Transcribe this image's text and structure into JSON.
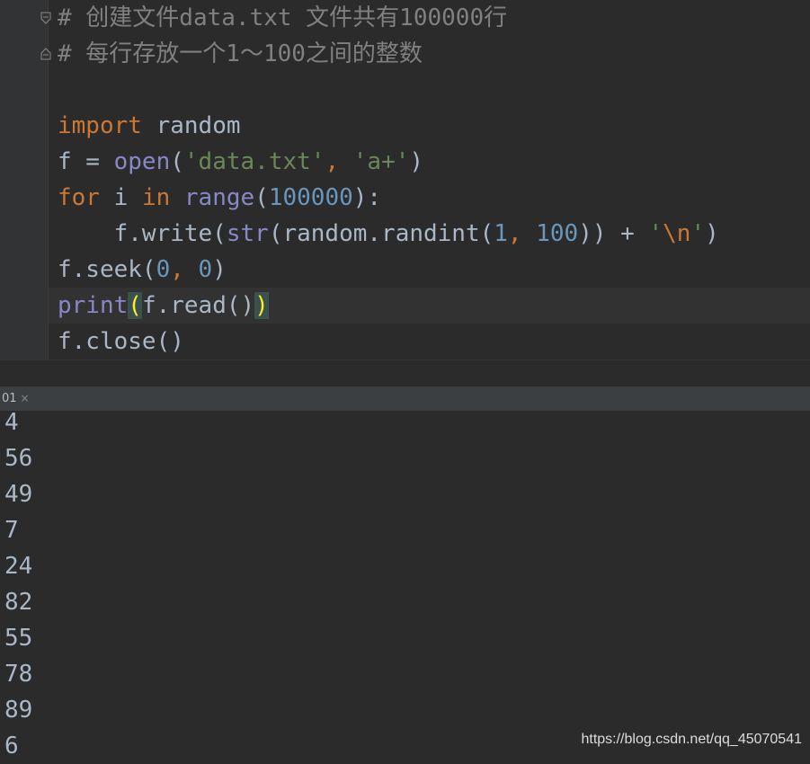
{
  "editor": {
    "lines": [
      {
        "tokens": [
          {
            "t": "# 创建文件data.txt 文件共有100000行",
            "c": "cm"
          }
        ]
      },
      {
        "tokens": [
          {
            "t": "# 每行存放一个1～100之间的整数",
            "c": "cm"
          }
        ]
      },
      {
        "tokens": []
      },
      {
        "tokens": [
          {
            "t": "import",
            "c": "kw"
          },
          {
            "t": " random",
            "c": ""
          }
        ]
      },
      {
        "tokens": [
          {
            "t": "f = ",
            "c": ""
          },
          {
            "t": "open",
            "c": "bi"
          },
          {
            "t": "(",
            "c": ""
          },
          {
            "t": "'data.txt'",
            "c": "str"
          },
          {
            "t": ", ",
            "c": "kw"
          },
          {
            "t": "'a+'",
            "c": "str"
          },
          {
            "t": ")",
            "c": ""
          }
        ]
      },
      {
        "tokens": [
          {
            "t": "for",
            "c": "kw"
          },
          {
            "t": " i ",
            "c": ""
          },
          {
            "t": "in",
            "c": "kw"
          },
          {
            "t": " ",
            "c": ""
          },
          {
            "t": "range",
            "c": "bi"
          },
          {
            "t": "(",
            "c": ""
          },
          {
            "t": "100000",
            "c": "num"
          },
          {
            "t": "):",
            "c": ""
          }
        ]
      },
      {
        "tokens": [
          {
            "t": "    f.write(",
            "c": ""
          },
          {
            "t": "str",
            "c": "bi"
          },
          {
            "t": "(random.randint(",
            "c": ""
          },
          {
            "t": "1",
            "c": "num"
          },
          {
            "t": ", ",
            "c": "kw"
          },
          {
            "t": "100",
            "c": "num"
          },
          {
            "t": ")) + ",
            "c": ""
          },
          {
            "t": "'",
            "c": "str"
          },
          {
            "t": "\\n",
            "c": "esc"
          },
          {
            "t": "'",
            "c": "str"
          },
          {
            "t": ")",
            "c": ""
          }
        ]
      },
      {
        "tokens": [
          {
            "t": "f.seek(",
            "c": ""
          },
          {
            "t": "0",
            "c": "num"
          },
          {
            "t": ", ",
            "c": "kw"
          },
          {
            "t": "0",
            "c": "num"
          },
          {
            "t": ")",
            "c": ""
          }
        ]
      },
      {
        "tokens": [
          {
            "t": "print",
            "c": "bi"
          },
          {
            "t": "(",
            "c": "brace-hl"
          },
          {
            "t": "f.read()",
            "c": ""
          },
          {
            "t": ")",
            "c": "brace-hl"
          }
        ],
        "current": true
      },
      {
        "tokens": [
          {
            "t": "f.close()",
            "c": ""
          }
        ]
      }
    ]
  },
  "run_panel": {
    "tab_label": "01",
    "close_glyph": "×",
    "output": [
      "4",
      "56",
      "49",
      "7",
      "24",
      "82",
      "55",
      "78",
      "89",
      "6"
    ]
  },
  "watermark": "https://blog.csdn.net/qq_45070541",
  "colors": {
    "background": "#2b2b2b",
    "keyword": "#cc7832",
    "builtin": "#8888c6",
    "string": "#6a8759",
    "number": "#6897bb",
    "comment": "#808080",
    "text": "#a9b7c6"
  }
}
